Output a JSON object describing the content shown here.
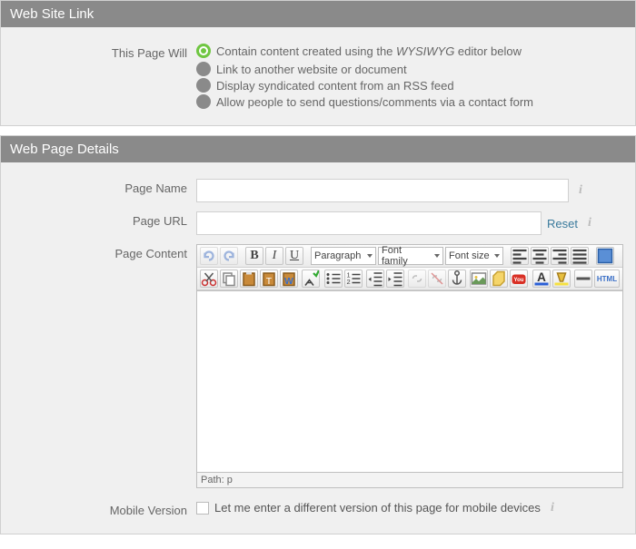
{
  "sections": {
    "link": {
      "title": "Web Site Link",
      "label": "This Page Will",
      "options": [
        {
          "label_pre": "Contain content created using the ",
          "label_em": "WYSIWYG",
          "label_post": " editor below",
          "checked": true
        },
        {
          "label": "Link to another website or document",
          "checked": false
        },
        {
          "label": "Display syndicated content from an RSS feed",
          "checked": false
        },
        {
          "label": "Allow people to send questions/comments via a contact form",
          "checked": false
        }
      ]
    },
    "details": {
      "title": "Web Page Details",
      "page_name_label": "Page Name",
      "page_name_value": "",
      "page_url_label": "Page URL",
      "page_url_value": "",
      "reset_label": "Reset",
      "page_content_label": "Page Content",
      "mobile_label": "Mobile Version",
      "mobile_checkbox_label": "Let me enter a different version of this page for mobile devices"
    }
  },
  "editor": {
    "format_select": "Paragraph",
    "font_family_select": "Font family",
    "font_size_select": "Font size",
    "status_path": "Path: p",
    "html_button": "HTML"
  }
}
